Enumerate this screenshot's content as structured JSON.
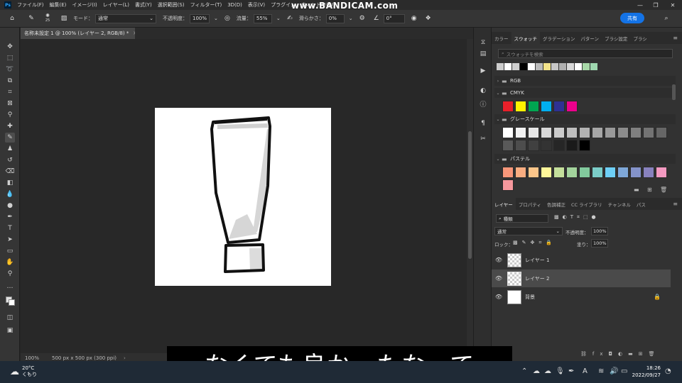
{
  "menubar": {
    "app_icon": "Ps",
    "items": [
      "ファイル(F)",
      "編集(E)",
      "イメージ(I)",
      "レイヤー(L)",
      "書式(Y)",
      "選択範囲(S)",
      "フィルター(T)",
      "3D(D)",
      "表示(V)",
      "プラグイン",
      "ウィンドウ(W)"
    ],
    "watermark": "www.BANDICAM.com"
  },
  "options": {
    "brush_size": "25",
    "mode_label": "モード：",
    "mode_value": "通常",
    "opacity_label": "不透明度：",
    "opacity_value": "100%",
    "flow_label": "流量：",
    "flow_value": "55%",
    "smoothing_label": "滑らかさ：",
    "smoothing_value": "0%",
    "angle_value": "0°",
    "share_label": "共有"
  },
  "document": {
    "tab_title": "名称未設定 1 @ 100% (レイヤー 2, RGB/8) *",
    "zoom": "100%",
    "doc_info": "500 px x 500 px (300 ppi)"
  },
  "swatches_panel": {
    "tabs": [
      "カラー",
      "スウォッチ",
      "グラデーション",
      "パターン",
      "ブラシ設定",
      "ブラシ"
    ],
    "active_tab": "スウォッチ",
    "search_placeholder": "スウォッチを検索",
    "recent": [
      "#cccccc",
      "#ffffff",
      "#cfcfcf",
      "#000000",
      "#ffffff",
      "#bbbbbb",
      "#f3e38a",
      "#c8c8c8",
      "#b0b0b0",
      "#d8d8d8",
      "#ffffff",
      "#a8d8a8",
      "#9fd8b0"
    ],
    "groups": [
      {
        "name": "RGB",
        "expanded": false
      },
      {
        "name": "CMYK",
        "expanded": true,
        "colors": [
          "#e8202a",
          "#fff200",
          "#00a651",
          "#00aeef",
          "#2e3192",
          "#ec008c"
        ]
      },
      {
        "name": "グレースケール",
        "expanded": true,
        "colors": [
          "#ffffff",
          "#f2f2f2",
          "#e6e6e6",
          "#d9d9d9",
          "#cccccc",
          "#bfbfbf",
          "#b3b3b3",
          "#a6a6a6",
          "#999999",
          "#8c8c8c",
          "#808080",
          "#737373",
          "#666666",
          "#595959",
          "#4d4d4d",
          "#404040",
          "#333333",
          "#262626",
          "#1a1a1a",
          "#000000"
        ]
      },
      {
        "name": "パステル",
        "expanded": true,
        "colors": [
          "#f7977a",
          "#f9ad81",
          "#fdc68a",
          "#fff79a",
          "#c4df9b",
          "#a3d39c",
          "#82ca9d",
          "#7bcdc8",
          "#6ecff6",
          "#7ea7d8",
          "#8493ca",
          "#8882be",
          "#f49ac1",
          "#f6989d"
        ]
      }
    ]
  },
  "layers_panel": {
    "tabs": [
      "レイヤー",
      "プロパティ",
      "色調補正",
      "CC ライブラリ",
      "チャンネル",
      "パス"
    ],
    "active_tab": "レイヤー",
    "filter_label": "種類",
    "blend_mode": "通常",
    "opacity_label": "不透明度：",
    "opacity_value": "100%",
    "lock_label": "ロック：",
    "fill_label": "塗り：",
    "fill_value": "100%",
    "layers": [
      {
        "name": "レイヤー 1",
        "selected": false
      },
      {
        "name": "レイヤー 2",
        "selected": true
      },
      {
        "name": "背景",
        "selected": false,
        "locked": true
      }
    ]
  },
  "subtitle": "なくても良かったなって",
  "taskbar": {
    "temperature": "20°C",
    "condition": "くもり",
    "time": "18:26",
    "date": "2022/09/27"
  }
}
